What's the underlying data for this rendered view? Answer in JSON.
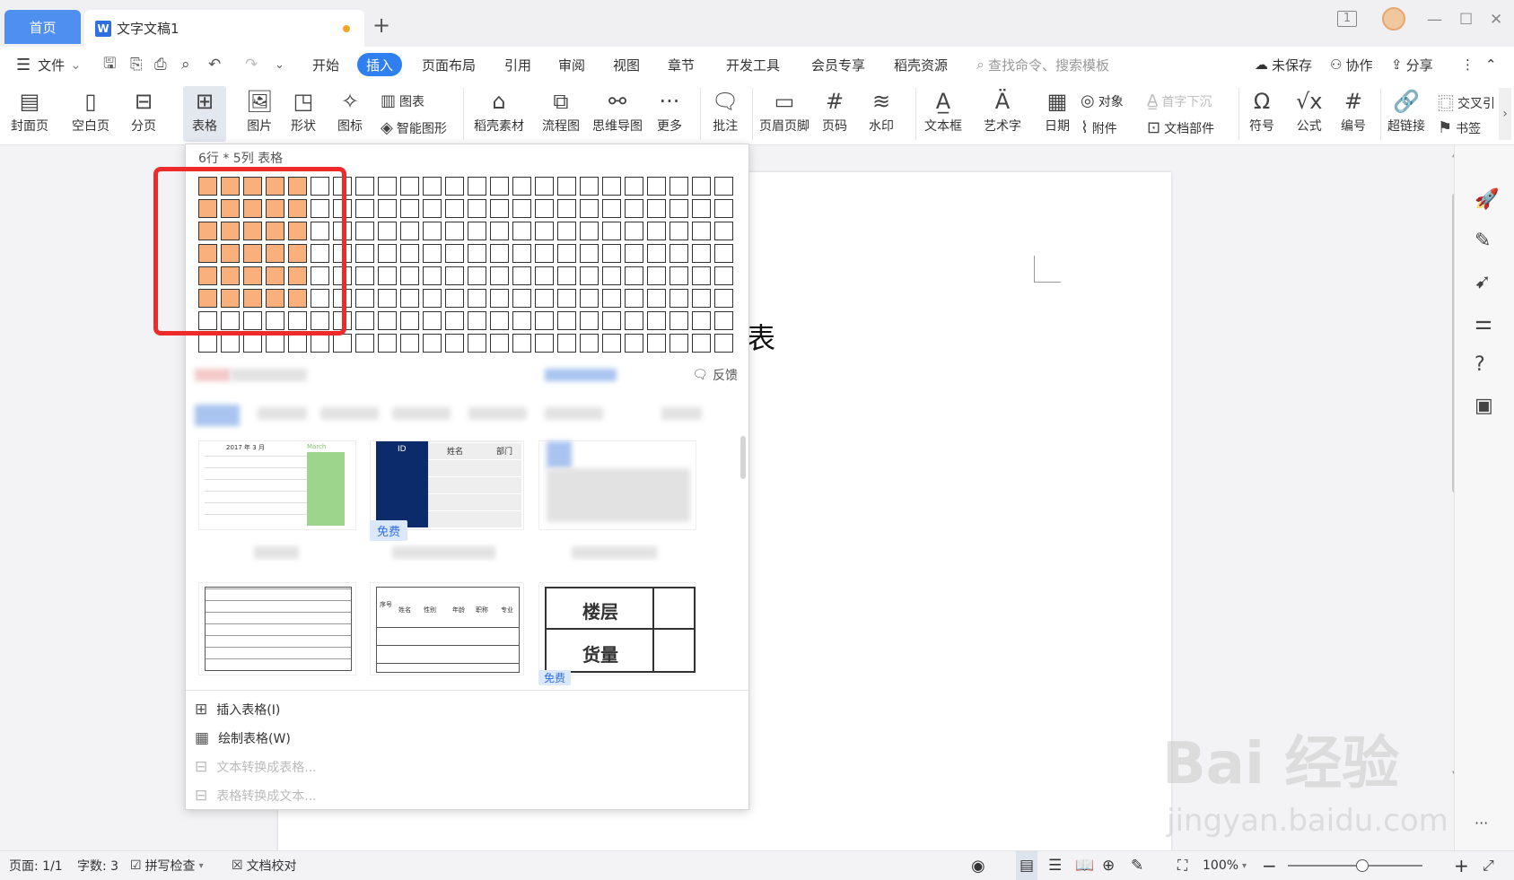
{
  "titlebar": {
    "home_tab": "首页",
    "doc_tab": "文字文稿1",
    "doc_icon": "W",
    "add_tab": "+",
    "page_count_badge": "1"
  },
  "menubar": {
    "file": "文件",
    "items": [
      "开始",
      "插入",
      "页面布局",
      "引用",
      "审阅",
      "视图",
      "章节",
      "开发工具",
      "会员专享",
      "稻壳资源"
    ],
    "active": "插入",
    "search_placeholder": "查找命令、搜索模板",
    "unsaved": "未保存",
    "collab": "协作",
    "share": "分享"
  },
  "ribbon": {
    "cover": "封面页",
    "blank_page": "空白页",
    "page_break": "分页",
    "table": "表格",
    "picture": "图片",
    "shape": "形状",
    "icon": "图标",
    "chart": "图表",
    "smart_shape": "智能图形",
    "docer_material": "稻壳素材",
    "flowchart": "流程图",
    "mindmap": "思维导图",
    "more": "更多",
    "comment": "批注",
    "header_footer": "页眉页脚",
    "page_number": "页码",
    "watermark": "水印",
    "textbox": "文本框",
    "wordart": "艺术字",
    "date": "日期",
    "object": "对象",
    "attachment": "附件",
    "dropcap": "首字下沉",
    "doc_parts": "文档部件",
    "symbol": "符号",
    "formula": "公式",
    "numbering": "编号",
    "hyperlink": "超链接",
    "crossref": "交叉引",
    "bookmark": "书签"
  },
  "dropdown": {
    "grid_label": "6行 * 5列 表格",
    "grid_rows": 8,
    "grid_cols": 24,
    "selected_rows": 6,
    "selected_cols": 5,
    "feedback": "反馈",
    "template_free": "免费",
    "tpl2_headers": [
      "ID",
      "姓名",
      "部门"
    ],
    "tpl1_header": "2017 年 3 月",
    "tpl1_month": "March",
    "tpl5_headers": [
      "序号",
      "姓名",
      "性别",
      "年龄",
      "职称",
      "专业"
    ],
    "tpl6_rows": [
      "楼层",
      "货量"
    ],
    "actions": {
      "insert_table": "插入表格(I)",
      "draw_table": "绘制表格(W)",
      "text_to_table": "文本转换成表格...",
      "table_to_text": "表格转换成文本..."
    }
  },
  "document": {
    "visible_char": "表"
  },
  "statusbar": {
    "page": "页面: 1/1",
    "words": "字数: 3",
    "spellcheck": "拼写检查",
    "proofread": "文档校对",
    "zoom": "100%"
  },
  "watermark": {
    "brand": "Bai 经验",
    "url": "jingyan.baidu.com"
  }
}
